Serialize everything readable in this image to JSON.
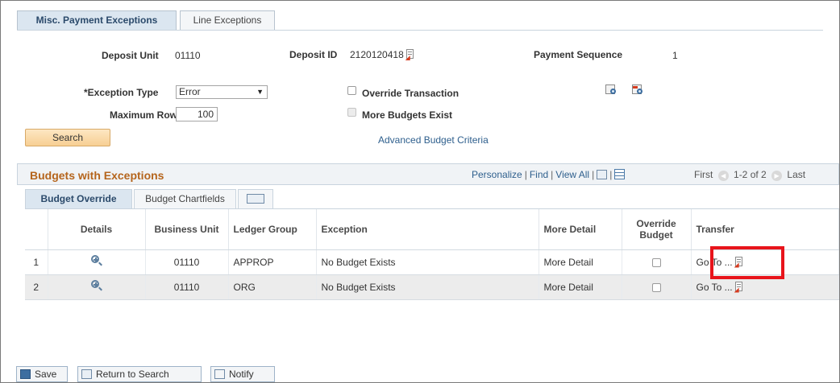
{
  "tabs": [
    {
      "label": "Misc. Payment Exceptions"
    },
    {
      "label": "Line Exceptions"
    }
  ],
  "header": {
    "deposit_unit_label": "Deposit Unit",
    "deposit_unit_value": "01110",
    "deposit_id_label": "Deposit ID",
    "deposit_id_value": "2120120418",
    "payment_sequence_label": "Payment Sequence",
    "payment_sequence_value": "1"
  },
  "criteria": {
    "exception_type_label": "*Exception Type",
    "exception_type_value": "Error",
    "maximum_rows_label": "Maximum Rows",
    "maximum_rows_value": "100",
    "override_transaction_label": "Override Transaction",
    "more_budgets_exist_label": "More Budgets Exist",
    "search_label": "Search",
    "advanced_link": "Advanced Budget Criteria"
  },
  "grid": {
    "title": "Budgets with Exceptions",
    "personalize": "Personalize",
    "find": "Find",
    "view_all": "View All",
    "first": "First",
    "range": "1-2 of 2",
    "last": "Last",
    "tabs": [
      "Budget Override",
      "Budget Chartfields"
    ],
    "columns": [
      "Details",
      "Business Unit",
      "Ledger Group",
      "Exception",
      "More Detail",
      "Override Budget",
      "Transfer"
    ],
    "rows": [
      {
        "num": "1",
        "business_unit": "01110",
        "ledger_group": "APPROP",
        "exception": "No Budget Exists",
        "more_detail": "More Detail",
        "transfer": "Go To ..."
      },
      {
        "num": "2",
        "business_unit": "01110",
        "ledger_group": "ORG",
        "exception": "No Budget Exists",
        "more_detail": "More Detail",
        "transfer": "Go To ..."
      }
    ]
  },
  "footer": {
    "save": "Save",
    "return_to_search": "Return to Search",
    "notify": "Notify"
  },
  "colors": {
    "accent_orange": "#b5651d",
    "link_blue": "#2e5f8d",
    "highlight_red": "#e8141b",
    "search_button": "#f7cf93"
  }
}
